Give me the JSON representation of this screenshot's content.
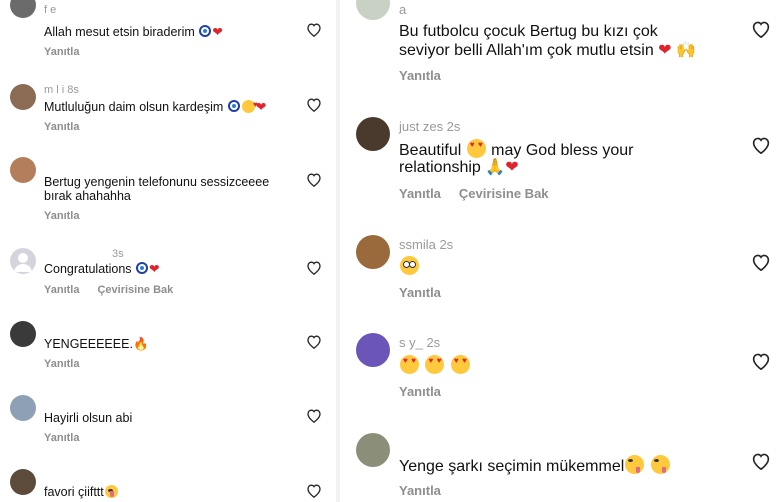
{
  "actions": {
    "reply": "Yanıtla",
    "translate": "Çevirisine Bak"
  },
  "left_comments": [
    {
      "user": "f          e",
      "text": "Allah mesut etsin biraderim",
      "emojis": [
        "nazar-amulet",
        "red-heart"
      ],
      "show_translate": false,
      "avatar_color": "#6b6b6b"
    },
    {
      "user": "m       l     i 8s",
      "text": "Mutluluğun daim olsun kardeşim",
      "emojis": [
        "nazar-amulet",
        "smiling-face-with-hearts",
        "red-heart"
      ],
      "show_translate": false,
      "avatar_color": "#8c6b55"
    },
    {
      "user": "",
      "text_line1": "Bertug yengenin telefonunu sessizceeee",
      "text_line2": "bırak ahahahha",
      "emojis": [],
      "show_translate": false,
      "avatar_color": "#b47d5c"
    },
    {
      "user": "3s",
      "text": "Congratulations",
      "emojis": [
        "nazar-amulet",
        "red-heart"
      ],
      "show_translate": true,
      "avatar_color": "#d4d4dc"
    },
    {
      "user": "",
      "text": "YENGEEEEEE.",
      "emojis": [
        "fire"
      ],
      "show_translate": false,
      "avatar_color": "#3a3a3a"
    },
    {
      "user": "",
      "text": "Hayirli olsun abi",
      "emojis": [],
      "show_translate": false,
      "avatar_color": "#8ea0b5"
    },
    {
      "user": "",
      "text": "favori çiifttt",
      "emojis": [
        "zany-face"
      ],
      "show_translate": false,
      "avatar_color": "#5c4a3a"
    }
  ],
  "right_comments": [
    {
      "user": "a",
      "text_line1": "Bu futbolcu çocuk Bertug bu          kızı çok",
      "text_line2": "seviyor belli Allah'ım çok mutlu etsin",
      "emojis": [
        "red-heart",
        "raising-hands"
      ],
      "show_translate": false,
      "avatar_color": "#c9d0c4"
    },
    {
      "user": "just          zes 2s",
      "text_line1": "Beautiful",
      "text_line1b": "may God bless your",
      "text_line2": "relationship",
      "emojis_line1": [
        "smiling-face-with-heart-eyes"
      ],
      "emojis": [
        "folded-hands",
        "red-heart"
      ],
      "show_translate": true,
      "avatar_color": "#4a3a2e"
    },
    {
      "user": "   ssmila 2s",
      "text": "",
      "emojis": [
        "flushed-face"
      ],
      "show_translate": false,
      "avatar_color": "#9b6a3c"
    },
    {
      "user": "s           y_ 2s",
      "text": "",
      "emojis": [
        "smiling-face-with-heart-eyes",
        "smiling-face-with-heart-eyes",
        "smiling-face-with-heart-eyes"
      ],
      "show_translate": false,
      "avatar_color": "#6b55b8"
    },
    {
      "user": "",
      "text": "Yenge şarkı seçimin mükemmel",
      "emojis": [
        "zany-face",
        "zany-face"
      ],
      "show_translate": false,
      "avatar_color": "#8b8f7a"
    }
  ]
}
